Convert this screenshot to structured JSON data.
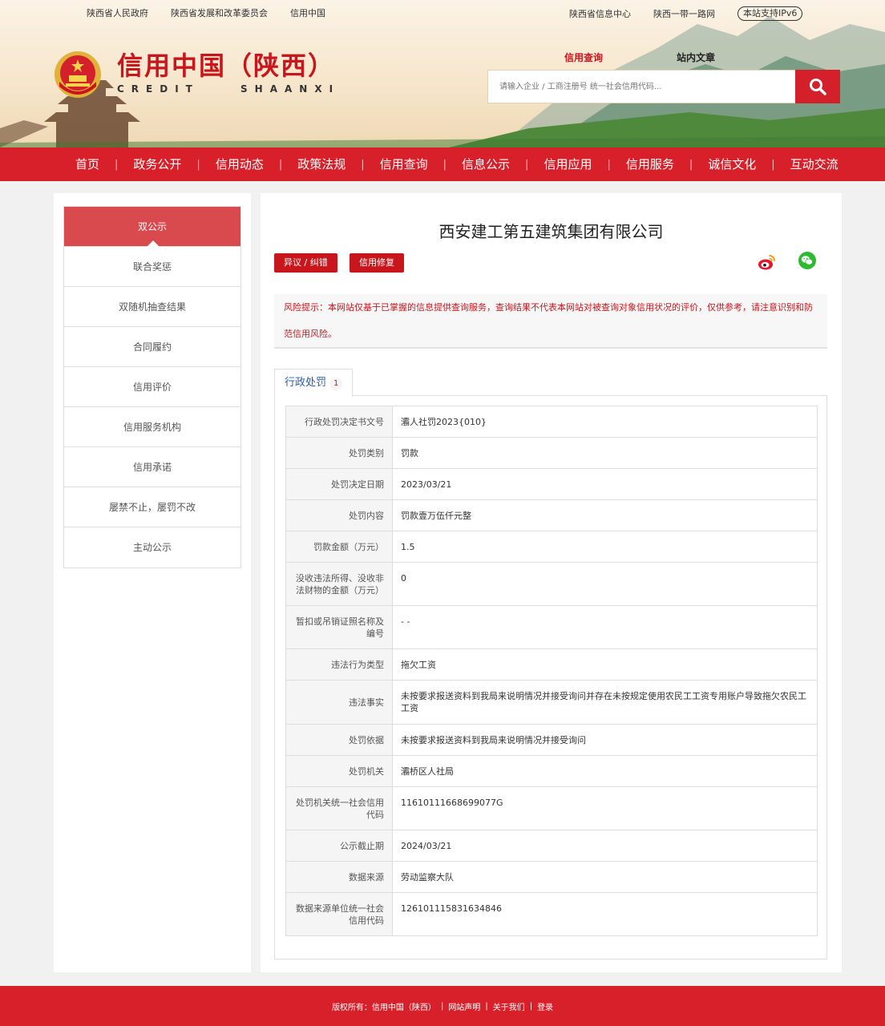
{
  "top_links_left": [
    "陕西省人民政府",
    "陕西省发展和改革委员会",
    "信用中国"
  ],
  "top_links_right": [
    "陕西省信息中心",
    "陕西一带一路网"
  ],
  "ipv6_badge": "本站支持IPv6",
  "brand": {
    "title_cn": "信用中国（陕西）",
    "title_en": "CREDIT SHAANXI"
  },
  "search": {
    "tab_active": "信用查询",
    "tab_inactive": "站内文章",
    "placeholder": "请输入企业 / 工商注册号 统一社会信用代码..."
  },
  "nav": [
    "首页",
    "政务公开",
    "信用动态",
    "政策法规",
    "信用查询",
    "信息公示",
    "信用应用",
    "信用服务",
    "诚信文化",
    "互动交流"
  ],
  "sidebar": [
    "双公示",
    "联合奖惩",
    "双随机抽查结果",
    "合同履约",
    "信用评价",
    "信用服务机构",
    "信用承诺",
    "屡禁不止，屡罚不改",
    "主动公示"
  ],
  "company_name": "西安建工第五建筑集团有限公司",
  "buttons": {
    "objection": "异议 / 纠错",
    "repair": "信用修复"
  },
  "risk_notice": "风险提示：本网站仅基于已掌握的信息提供查询服务，查询结果不代表本网站对被查询对象信用状况的评价，仅供参考，请注意识别和防范信用风险。",
  "tab": {
    "label": "行政处罚",
    "count": "1"
  },
  "penalty": [
    {
      "k": "行政处罚决定书文号",
      "v": "灞人社罚2023{010}"
    },
    {
      "k": "处罚类别",
      "v": "罚款"
    },
    {
      "k": "处罚决定日期",
      "v": "2023/03/21"
    },
    {
      "k": "处罚内容",
      "v": "罚款壹万伍仟元整"
    },
    {
      "k": "罚款金额（万元）",
      "v": "1.5"
    },
    {
      "k": "没收违法所得、没收非法财物的金额（万元）",
      "v": "0"
    },
    {
      "k": "暂扣或吊销证照名称及编号",
      "v": "- -"
    },
    {
      "k": "违法行为类型",
      "v": "拖欠工资"
    },
    {
      "k": "违法事实",
      "v": "未按要求报送资料到我局来说明情况并接受询问并存在未按规定使用农民工工资专用账户导致拖欠农民工工资"
    },
    {
      "k": "处罚依据",
      "v": "未按要求报送资料到我局来说明情况并接受询问"
    },
    {
      "k": "处罚机关",
      "v": "灞桥区人社局"
    },
    {
      "k": "处罚机关统一社会信用代码",
      "v": "11610111668699077G"
    },
    {
      "k": "公示截止期",
      "v": "2024/03/21"
    },
    {
      "k": "数据来源",
      "v": "劳动监察大队"
    },
    {
      "k": "数据来源单位统一社会信用代码",
      "v": "126101115831634846"
    }
  ],
  "footer": {
    "copyright": "版权所有：信用中国（陕西）",
    "statement": "网站声明",
    "about": "关于我们",
    "login": "登录"
  },
  "colors": {
    "brand_red": "#d8202a",
    "link_blue": "#2a5caa"
  },
  "icons": {
    "search": "magnifier-icon",
    "weibo": "weibo-icon",
    "wechat": "wechat-icon",
    "emblem": "national-emblem-icon"
  }
}
